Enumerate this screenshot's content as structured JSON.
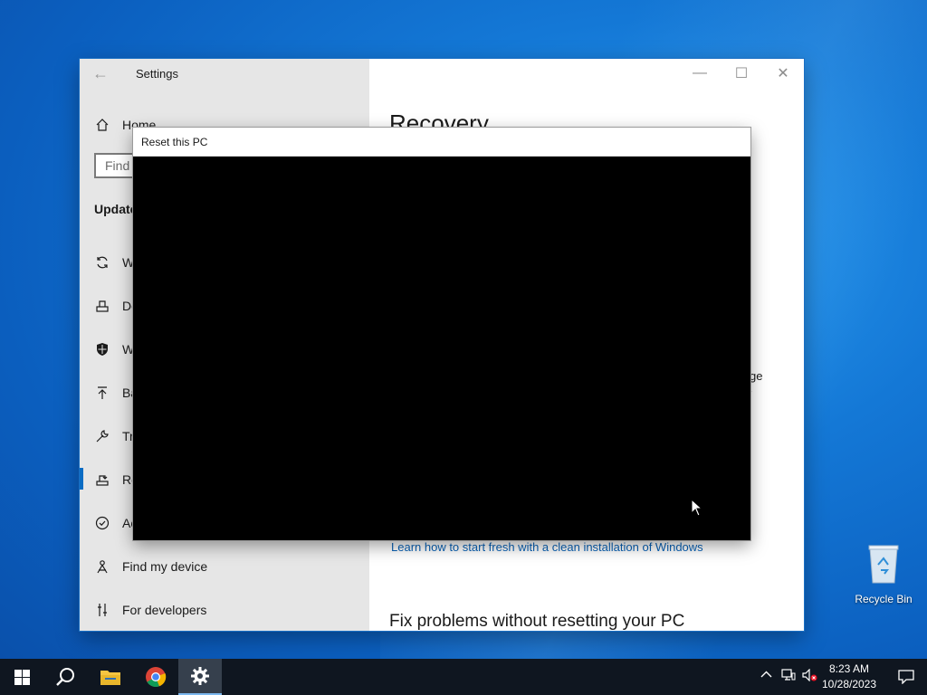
{
  "settings": {
    "window_title": "Settings",
    "controls": {
      "minimize": "—",
      "maximize": "☐",
      "close": "✕"
    },
    "sidebar": {
      "home_label": "Home",
      "search_placeholder": "Find a",
      "section_heading": "Update",
      "items": [
        {
          "label": "W",
          "icon": "sync-icon"
        },
        {
          "label": "De",
          "icon": "delivery-optimization-icon"
        },
        {
          "label": "W",
          "icon": "windows-security-icon"
        },
        {
          "label": "Ba",
          "icon": "backup-icon"
        },
        {
          "label": "Tr",
          "icon": "troubleshoot-icon"
        },
        {
          "label": "Re",
          "icon": "recovery-icon",
          "selected": true
        },
        {
          "label": "Ac",
          "icon": "activation-icon"
        },
        {
          "label": "Find my device",
          "icon": "find-my-device-icon"
        },
        {
          "label": "For developers",
          "icon": "developers-icon"
        }
      ]
    },
    "main": {
      "page_title": "Recovery",
      "fragment_a": "ge",
      "fragment_b": "r",
      "learn_link": "Learn how to start fresh with a clean installation of Windows",
      "fix_heading": "Fix problems without resetting your PC"
    }
  },
  "dialog": {
    "title": "Reset this PC"
  },
  "desktop": {
    "recycle_bin_label": "Recycle Bin"
  },
  "taskbar": {
    "clock_time": "8:23 AM",
    "clock_date": "10/28/2023",
    "accent_color": "#0a6cc4"
  }
}
